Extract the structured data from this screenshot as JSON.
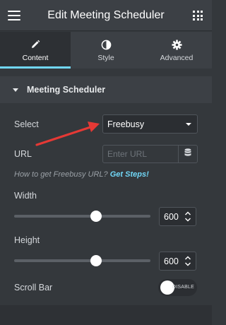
{
  "header": {
    "title": "Edit Meeting Scheduler",
    "menu_icon": "hamburger-icon",
    "apps_icon": "grid-icon"
  },
  "tabs": [
    {
      "label": "Content",
      "icon": "pencil-icon",
      "active": true
    },
    {
      "label": "Style",
      "icon": "contrast-icon",
      "active": false
    },
    {
      "label": "Advanced",
      "icon": "gear-icon",
      "active": false
    }
  ],
  "section": {
    "title": "Meeting Scheduler",
    "expanded": true
  },
  "fields": {
    "select": {
      "label": "Select",
      "value": "Freebusy"
    },
    "url": {
      "label": "URL",
      "placeholder": "Enter URL",
      "value": ""
    },
    "help": {
      "text": "How to get Freebusy URL?",
      "link": "Get Steps!"
    },
    "width": {
      "label": "Width",
      "value": "600",
      "slider_fraction": 0.6
    },
    "height": {
      "label": "Height",
      "value": "600",
      "slider_fraction": 0.6
    },
    "scrollbar": {
      "label": "Scroll Bar",
      "toggle_text": "DISABLE",
      "enabled": false
    }
  },
  "colors": {
    "accent": "#71d7f7",
    "annotation_arrow": "#e53935",
    "panel_bg": "#34383c"
  }
}
